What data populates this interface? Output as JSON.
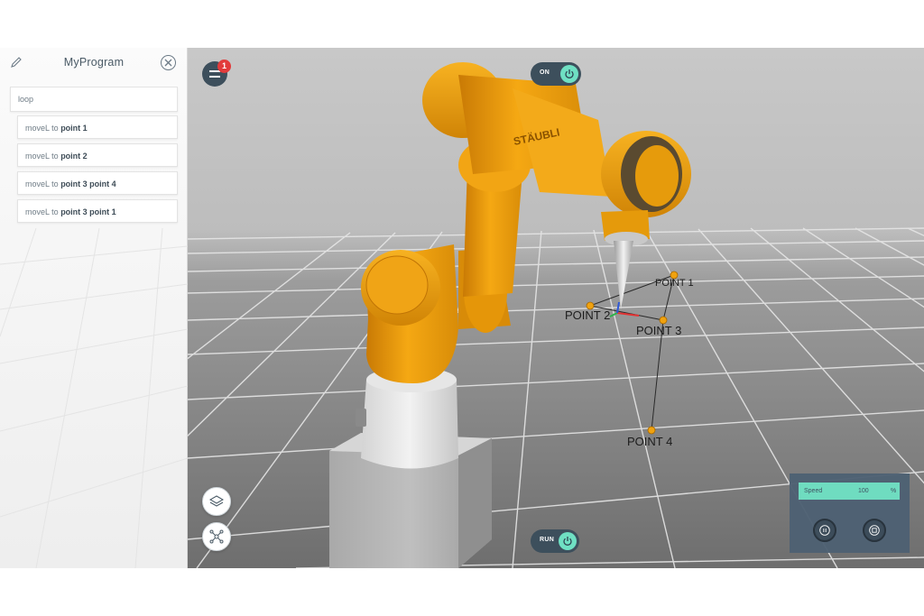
{
  "program": {
    "title": "MyProgram",
    "loop_label": "loop",
    "commands": [
      {
        "verb": "moveL to",
        "target": "point 1"
      },
      {
        "verb": "moveL to",
        "target": "point 2"
      },
      {
        "verb": "moveL to",
        "target": "point 3 point 4"
      },
      {
        "verb": "moveL to",
        "target": "point 3 point 1"
      }
    ]
  },
  "menu": {
    "badge_count": "1"
  },
  "power_toggle": {
    "label": "ON"
  },
  "run_toggle": {
    "label": "RUN"
  },
  "robot": {
    "brand_text": "STÄUBLI",
    "body_color": "#f0a20f"
  },
  "points": [
    {
      "label": "POINT 1"
    },
    {
      "label": "POINT 2"
    },
    {
      "label": "POINT 3"
    },
    {
      "label": "POINT 4"
    }
  ],
  "speed": {
    "label": "Speed",
    "value": "100",
    "unit": "%"
  },
  "icons": {
    "edit": "pencil-icon",
    "close": "close-circle-icon",
    "menu": "hamburger-icon",
    "power": "power-icon",
    "layers": "layers-icon",
    "network": "network-icon",
    "pause": "pause-icon",
    "stop": "stop-icon"
  },
  "colors": {
    "accent": "#6fe0c3",
    "dark": "#3d4f5c",
    "badge": "#e23b3b",
    "panel": "#4e6173"
  }
}
